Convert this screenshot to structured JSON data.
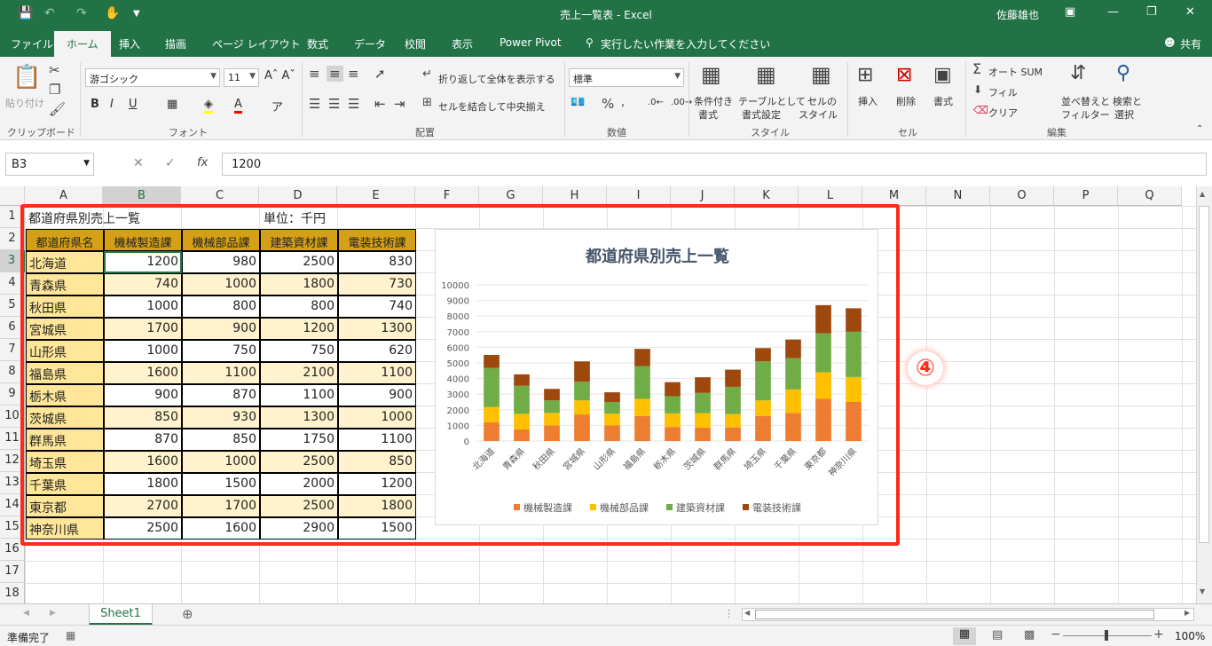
{
  "window": {
    "title": "売上一覧表 - Excel",
    "user": "佐藤雄也",
    "share": "共有"
  },
  "tabs": [
    "ファイル",
    "ホーム",
    "挿入",
    "描画",
    "ページ レイアウト",
    "数式",
    "データ",
    "校閲",
    "表示",
    "Power Pivot"
  ],
  "tell_me": "実行したい作業を入力してください",
  "ribbon": {
    "paste": "貼り付け",
    "font_name": "游ゴシック",
    "font_size": "11",
    "wrap_text": "折り返して全体を表示する",
    "merge_center": "セルを結合して中央揃え",
    "number_format": "標準",
    "conditional_format": "条件付き",
    "conditional_format2": "書式",
    "format_table": "テーブルとして",
    "format_table2": "書式設定",
    "cell_style": "セルの",
    "cell_style2": "スタイル",
    "insert": "挿入",
    "delete": "削除",
    "format": "書式",
    "autosum": "オート SUM",
    "fill": "フィル",
    "clear": "クリア",
    "sort": "並べ替えと",
    "sort2": "フィルター",
    "find": "検索と",
    "find2": "選択",
    "groups": {
      "clipboard": "クリップボード",
      "font": "フォント",
      "alignment": "配置",
      "number": "数値",
      "styles": "スタイル",
      "cells": "セル",
      "editing": "編集"
    }
  },
  "formula_bar": {
    "name_box": "B3",
    "value": "1200"
  },
  "columns": [
    "A",
    "B",
    "C",
    "D",
    "E",
    "F",
    "G",
    "H",
    "I",
    "J",
    "K",
    "L",
    "M",
    "N",
    "O",
    "P",
    "Q"
  ],
  "rows": [
    "1",
    "2",
    "3",
    "4",
    "5",
    "6",
    "7",
    "8",
    "9",
    "10",
    "11",
    "12",
    "13",
    "14",
    "15",
    "16",
    "17",
    "18"
  ],
  "sheet": {
    "a1": "都道府県別売上一覧",
    "d1": "単位：千円",
    "headers": [
      "都道府県名",
      "機械製造課",
      "機械部品課",
      "建築資材課",
      "電装技術課"
    ],
    "data": [
      [
        "北海道",
        "1200",
        "980",
        "2500",
        "830"
      ],
      [
        "青森県",
        "740",
        "1000",
        "1800",
        "730"
      ],
      [
        "秋田県",
        "1000",
        "800",
        "800",
        "740"
      ],
      [
        "宮城県",
        "1700",
        "900",
        "1200",
        "1300"
      ],
      [
        "山形県",
        "1000",
        "750",
        "750",
        "620"
      ],
      [
        "福島県",
        "1600",
        "1100",
        "2100",
        "1100"
      ],
      [
        "栃木県",
        "900",
        "870",
        "1100",
        "900"
      ],
      [
        "茨城県",
        "850",
        "930",
        "1300",
        "1000"
      ],
      [
        "群馬県",
        "870",
        "850",
        "1750",
        "1100"
      ],
      [
        "埼玉県",
        "1600",
        "1000",
        "2500",
        "850"
      ],
      [
        "千葉県",
        "1800",
        "1500",
        "2000",
        "1200"
      ],
      [
        "東京都",
        "2700",
        "1700",
        "2500",
        "1800"
      ],
      [
        "神奈川県",
        "2500",
        "1600",
        "2900",
        "1500"
      ]
    ]
  },
  "chart_data": {
    "type": "bar",
    "stacked": true,
    "title": "都道府県別売上一覧",
    "categories": [
      "北海道",
      "青森県",
      "秋田県",
      "宮城県",
      "山形県",
      "福島県",
      "栃木県",
      "茨城県",
      "群馬県",
      "埼玉県",
      "千葉県",
      "東京都",
      "神奈川県"
    ],
    "series": [
      {
        "name": "機械製造課",
        "color": "#ed7d31",
        "values": [
          1200,
          740,
          1000,
          1700,
          1000,
          1600,
          900,
          850,
          870,
          1600,
          1800,
          2700,
          2500
        ]
      },
      {
        "name": "機械部品課",
        "color": "#ffc000",
        "values": [
          980,
          1000,
          800,
          900,
          750,
          1100,
          870,
          930,
          850,
          1000,
          1500,
          1700,
          1600
        ]
      },
      {
        "name": "建築資材課",
        "color": "#70ad47",
        "values": [
          2500,
          1800,
          800,
          1200,
          750,
          2100,
          1100,
          1300,
          1750,
          2500,
          2000,
          2500,
          2900
        ]
      },
      {
        "name": "電装技術課",
        "color": "#9e480e",
        "values": [
          830,
          730,
          740,
          1300,
          620,
          1100,
          900,
          1000,
          1100,
          850,
          1200,
          1800,
          1500
        ]
      }
    ],
    "ylim": [
      0,
      10000
    ],
    "yticks": [
      "0",
      "1000",
      "2000",
      "3000",
      "4000",
      "5000",
      "6000",
      "7000",
      "8000",
      "9000",
      "10000"
    ],
    "grid": true,
    "legend": "bottom"
  },
  "annotation": {
    "badge": "④",
    "box_color": "#ff2a1a"
  },
  "sheet_tab": "Sheet1",
  "status": {
    "ready": "準備完了",
    "zoom": "100%"
  }
}
